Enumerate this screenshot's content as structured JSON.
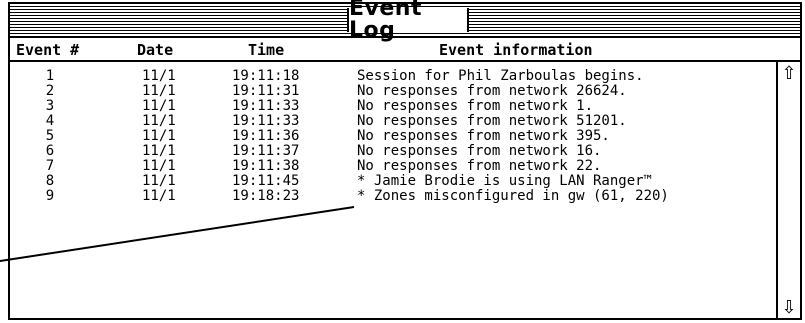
{
  "window": {
    "title": "Event Log"
  },
  "table": {
    "headers": [
      "Event #",
      "Date",
      "Time",
      "Event information"
    ],
    "rows": [
      {
        "num": "1",
        "date": "11/1",
        "time": "19:11:18",
        "info": "Session for Phil Zarboulas begins."
      },
      {
        "num": "2",
        "date": "11/1",
        "time": "19:11:31",
        "info": "No responses from network 26624."
      },
      {
        "num": "3",
        "date": "11/1",
        "time": "19:11:33",
        "info": "No responses from network 1."
      },
      {
        "num": "4",
        "date": "11/1",
        "time": "19:11:33",
        "info": "No responses from network 51201."
      },
      {
        "num": "5",
        "date": "11/1",
        "time": "19:11:36",
        "info": "No responses from network 395."
      },
      {
        "num": "6",
        "date": "11/1",
        "time": "19:11:37",
        "info": "No responses from network 16."
      },
      {
        "num": "7",
        "date": "11/1",
        "time": "19:11:38",
        "info": "No responses from network 22."
      },
      {
        "num": "8",
        "date": "11/1",
        "time": "19:11:45",
        "info": "* Jamie Brodie is using LAN Ranger™"
      },
      {
        "num": "9",
        "date": "11/1",
        "time": "19:18:23",
        "info": "* Zones misconfigured in gw (61, 220)"
      }
    ]
  },
  "scrollbar": {
    "up_icon": "up-arrow-icon",
    "down_icon": "down-arrow-icon",
    "up_glyph": "⇧",
    "down_glyph": "⇩"
  }
}
